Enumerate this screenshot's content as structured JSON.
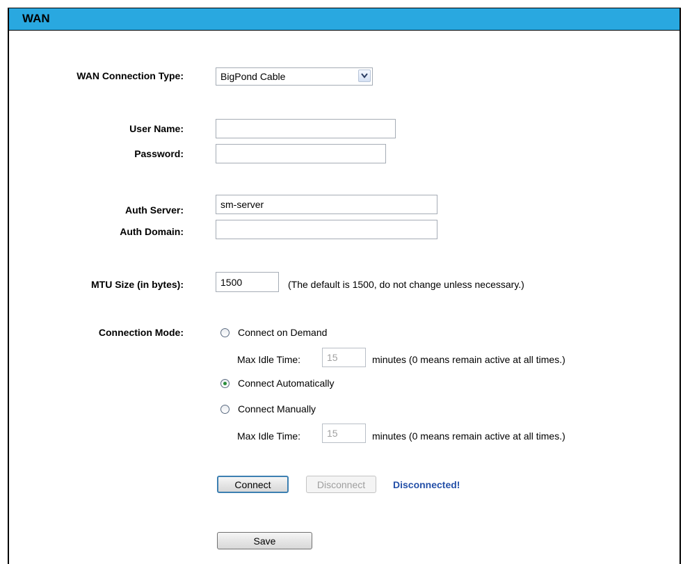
{
  "header": {
    "title": "WAN"
  },
  "connection_type": {
    "label": "WAN Connection Type:",
    "value": "BigPond Cable"
  },
  "user_name": {
    "label": "User Name:",
    "value": ""
  },
  "password": {
    "label": "Password:",
    "value": ""
  },
  "auth_server": {
    "label": "Auth Server:",
    "value": "sm-server"
  },
  "auth_domain": {
    "label": "Auth Domain:",
    "value": ""
  },
  "mtu": {
    "label": "MTU Size (in bytes):",
    "value": "1500",
    "hint": "(The default is 1500, do not change unless necessary.)"
  },
  "connection_mode": {
    "label": "Connection Mode:",
    "options": [
      {
        "label": "Connect on Demand",
        "selected": false
      },
      {
        "label": "Connect Automatically",
        "selected": true
      },
      {
        "label": "Connect Manually",
        "selected": false
      }
    ],
    "idle_demand": {
      "label": "Max Idle Time:",
      "value": "15",
      "suffix": "minutes (0 means remain active at all times.)"
    },
    "idle_manual": {
      "label": "Max Idle Time:",
      "value": "15",
      "suffix": "minutes (0 means remain active at all times.)"
    }
  },
  "actions": {
    "connect_label": "Connect",
    "disconnect_label": "Disconnect",
    "status": "Disconnected!",
    "status_color": "#2450a8"
  },
  "save_label": "Save",
  "colors": {
    "header": "#29a8e0"
  }
}
